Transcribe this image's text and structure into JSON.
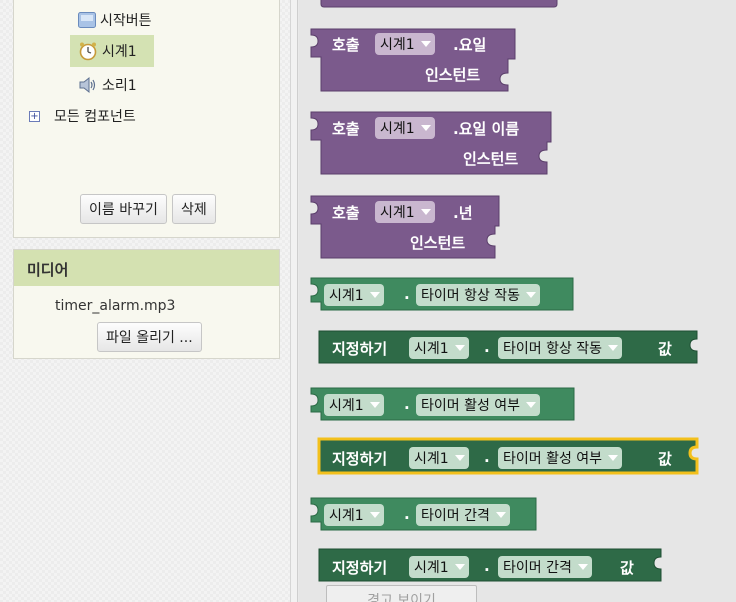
{
  "components": {
    "start_button": "시작버튼",
    "clock": "시계1",
    "sound": "소리1",
    "all_components": "모든 컴포넌트",
    "rename_label": "이름 바꾸기",
    "delete_label": "삭제"
  },
  "media": {
    "title": "미디어",
    "file": "timer_alarm.mp3",
    "upload_label": "파일 올리기 ..."
  },
  "blocks": {
    "call": "호출",
    "instant": "인스턴트",
    "component": "시계1",
    "weekday": ".요일",
    "weekday_name": ".요일 이름",
    "year": ".년",
    "dot": ".",
    "set": "지정하기",
    "value": "값",
    "timer_always": "타이머 항상 작동",
    "timer_enabled": "타이머 활성 여부",
    "timer_interval": "타이머 간격"
  },
  "workspace": {
    "warnings_label": "경고 보이기"
  },
  "colors": {
    "purple": "#7b5a8c",
    "green": "#3f8a5f",
    "dark_green": "#2e6a47",
    "highlight": "#f3c01c"
  }
}
